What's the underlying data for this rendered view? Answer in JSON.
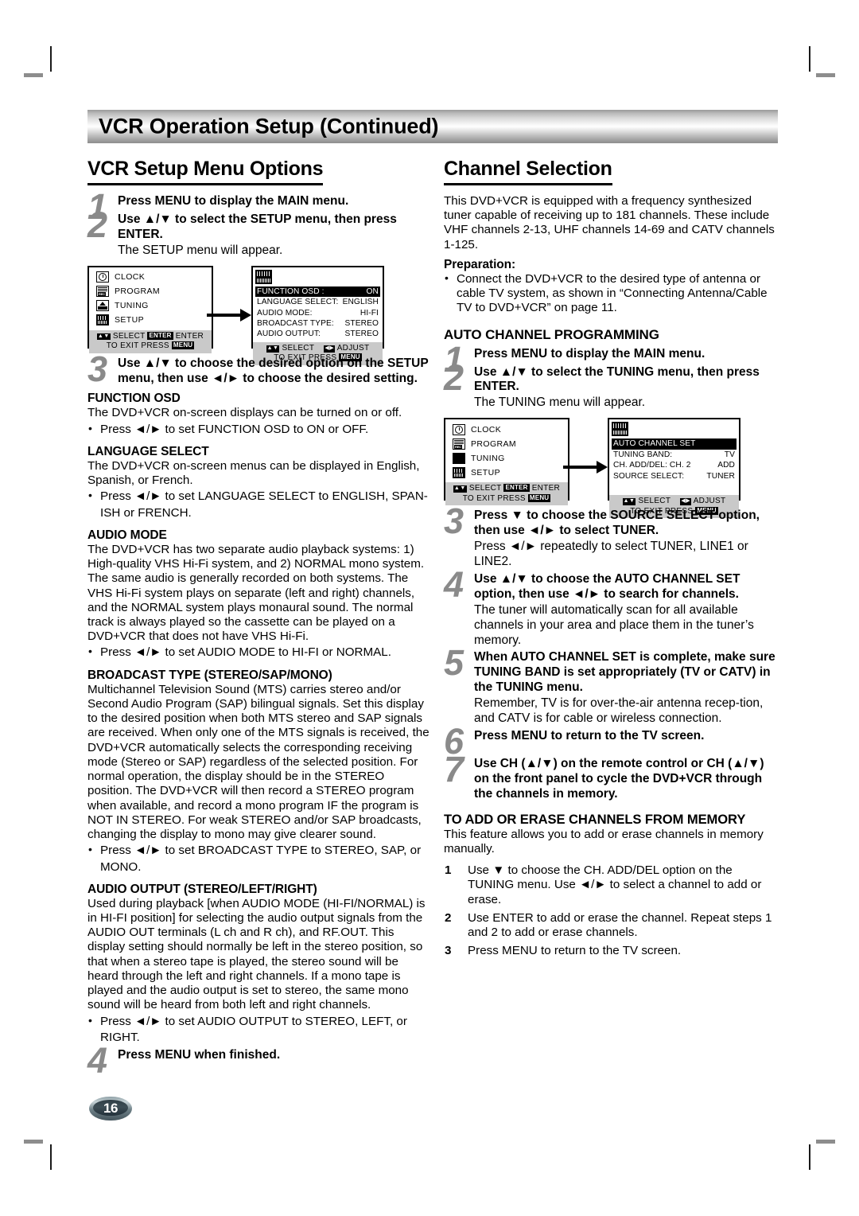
{
  "banner": {
    "title": "VCR Operation Setup (Continued)"
  },
  "page": {
    "number": "16"
  },
  "left": {
    "heading": "VCR Setup Menu Options",
    "steps": [
      {
        "num": "1",
        "bold": "Press MENU to display the MAIN menu.",
        "sub": ""
      },
      {
        "num": "2",
        "bold": "Use ▲/▼ to select the SETUP menu, then press ENTER.",
        "sub": "The SETUP menu will appear."
      },
      {
        "num": "3",
        "bold": "Use ▲/▼ to choose the desired option on the SETUP menu, then use ◄/► to choose the desired setting.",
        "sub": ""
      },
      {
        "num": "4",
        "bold": "Press MENU when finished.",
        "sub": ""
      }
    ],
    "osd": {
      "main_menu": {
        "items": [
          {
            "icon": "clock-icon",
            "label": "CLOCK",
            "selected": false
          },
          {
            "icon": "program-icon",
            "label": "PROGRAM",
            "selected": false
          },
          {
            "icon": "tuning-icon",
            "label": "TUNING",
            "selected": false
          },
          {
            "icon": "setup-icon",
            "label": "SETUP",
            "selected": true
          }
        ],
        "foot_line1_a": "SELECT",
        "foot_line1_key": "ENTER",
        "foot_line1_b": "ENTER",
        "foot_line2_a": "TO  EXIT PRESS",
        "foot_line2_key": "MENU"
      },
      "detail_menu": {
        "badge": "setup-icon",
        "rows": [
          {
            "label": "FUNCTION OSD :",
            "value": "ON",
            "highlight": true
          },
          {
            "label": "LANGUAGE SELECT:",
            "value": "ENGLISH",
            "highlight": false
          },
          {
            "label": "AUDIO MODE:",
            "value": "HI-FI",
            "highlight": false
          },
          {
            "label": "BROADCAST TYPE:",
            "value": "STEREO",
            "highlight": false
          },
          {
            "label": "AUDIO OUTPUT:",
            "value": "STEREO",
            "highlight": false
          }
        ],
        "foot_line1_a": "SELECT",
        "foot_line1_b": "ADJUST",
        "foot_line2_a": "TO  EXIT PRESS",
        "foot_line2_key": "MENU"
      }
    },
    "sections": [
      {
        "title": "FUNCTION OSD",
        "body": "The DVD+VCR on-screen displays can be turned on or off.",
        "bullet": "Press ◄/► to set FUNCTION OSD to ON or OFF.",
        "bullet_cont": ""
      },
      {
        "title": "LANGUAGE SELECT",
        "body": "The DVD+VCR on-screen menus can be displayed in English, Spanish, or French.",
        "bullet": "Press ◄/► to set LANGUAGE SELECT to ENGLISH, SPAN-",
        "bullet_cont": "ISH or FRENCH."
      },
      {
        "title": "AUDIO MODE",
        "body": "The DVD+VCR has two separate audio playback systems: 1) High-quality VHS Hi-Fi system, and 2) NORMAL mono system. The same audio is generally recorded on both systems. The VHS Hi-Fi system plays on separate (left and right) channels, and the NORMAL system plays monaural sound. The normal track is always played so the cassette can be played on a DVD+VCR that does not have VHS Hi-Fi.",
        "bullet": "Press ◄/► to set AUDIO MODE to HI-FI or NORMAL.",
        "bullet_cont": ""
      },
      {
        "title": "BROADCAST TYPE (STEREO/SAP/MONO)",
        "body": "Multichannel Television Sound (MTS) carries stereo and/or Second Audio Program (SAP) bilingual signals. Set this display to the desired position when both MTS stereo and SAP signals are received. When only one of the MTS signals is received, the DVD+VCR automatically selects the corresponding receiving mode (Stereo or SAP) regardless of the selected position. For normal operation, the display should be in the STEREO position. The DVD+VCR will then record a STEREO program when available, and record a mono program IF the program is NOT IN STEREO. For weak STEREO and/or SAP broadcasts, changing the display to mono may give clearer sound.",
        "bullet": "Press ◄/► to set BROADCAST TYPE to STEREO, SAP, or",
        "bullet_cont": "MONO."
      },
      {
        "title": "AUDIO OUTPUT (STEREO/LEFT/RIGHT)",
        "body": "Used during playback [when AUDIO MODE (HI-FI/NORMAL) is in HI-FI position] for selecting the audio output signals from the AUDIO OUT terminals (L ch and R ch), and RF.OUT. This display setting should normally be left in the stereo position, so that when a stereo tape is played, the stereo sound will be heard through the left and right channels. If a mono tape is played and the audio output is set to stereo, the same mono sound will be heard from both left and right channels.",
        "bullet": "Press ◄/► to set AUDIO OUTPUT to STEREO, LEFT, or",
        "bullet_cont": "RIGHT."
      }
    ]
  },
  "right": {
    "heading": "Channel Selection",
    "intro": "This DVD+VCR is equipped with a frequency synthesized tuner capable of receiving up to 181 channels. These include VHF channels 2-13, UHF channels 14-69 and CATV channels 1-125.",
    "preparation_title": "Preparation:",
    "preparation_bullet": "Connect the DVD+VCR to the desired type of antenna or cable TV system, as shown in “Connecting Antenna/Cable TV to DVD+VCR” on page 11.",
    "auto_title": "AUTO CHANNEL PROGRAMMING",
    "auto_steps": [
      {
        "num": "1",
        "bold": "Press MENU to display the MAIN menu.",
        "sub": ""
      },
      {
        "num": "2",
        "bold": "Use ▲/▼ to select the TUNING menu, then press ENTER.",
        "sub": "The TUNING menu will appear."
      },
      {
        "num": "3",
        "bold": "Press ▼ to choose the SOURCE SELECT option, then use ◄/► to select TUNER.",
        "sub": "Press ◄/► repeatedly to select TUNER, LINE1 or LINE2."
      },
      {
        "num": "4",
        "bold": "Use ▲/▼ to choose the AUTO CHANNEL SET option, then use ◄/► to search for channels.",
        "sub": "The tuner will automatically scan for all available channels in your area and place them in the tuner’s memory."
      },
      {
        "num": "5",
        "bold": "When AUTO CHANNEL SET is complete, make sure TUNING BAND is set appropriately (TV or CATV) in the TUNING menu.",
        "sub": "Remember, TV is for over-the-air antenna recep-tion, and CATV is for cable or wireless connection."
      },
      {
        "num": "6",
        "bold": "Press MENU to return to the TV screen.",
        "sub": ""
      },
      {
        "num": "7",
        "bold": "Use CH (▲/▼) on the remote control or CH (▲/▼) on the front panel to cycle the DVD+VCR through the channels in memory.",
        "sub": ""
      }
    ],
    "osd": {
      "main_menu": {
        "items": [
          {
            "icon": "clock-icon",
            "label": "CLOCK",
            "selected": false
          },
          {
            "icon": "program-icon",
            "label": "PROGRAM",
            "selected": false
          },
          {
            "icon": "tuning-icon",
            "label": "TUNING",
            "selected": true
          },
          {
            "icon": "setup-icon",
            "label": "SETUP",
            "selected": false
          }
        ],
        "foot_line1_a": "SELECT",
        "foot_line1_key": "ENTER",
        "foot_line1_b": "ENTER",
        "foot_line2_a": "TO  EXIT PRESS",
        "foot_line2_key": "MENU"
      },
      "detail_menu": {
        "badge": "tuning-icon",
        "rows": [
          {
            "label": "AUTO CHANNEL SET",
            "value": "",
            "highlight": true
          },
          {
            "label": "TUNING BAND:",
            "value": "TV",
            "highlight": false
          },
          {
            "label": "CH.  ADD/DEL: CH. 2",
            "value": "ADD",
            "highlight": false
          },
          {
            "label": "SOURCE SELECT:",
            "value": "TUNER",
            "highlight": false
          }
        ],
        "foot_line1_a": "SELECT",
        "foot_line1_b": "ADJUST",
        "foot_line2_a": "TO  EXIT PRESS",
        "foot_line2_key": "MENU"
      }
    },
    "addr_title": "TO ADD OR ERASE CHANNELS FROM MEMORY",
    "addr_body": "This feature allows you to add or erase channels in memory manually.",
    "addr_steps": [
      {
        "num": "1",
        "text": "Use ▼ to choose the CH. ADD/DEL option on the TUNING menu. Use ◄/► to select a channel to add or erase."
      },
      {
        "num": "2",
        "text": "Use ENTER to add or erase the channel. Repeat steps 1 and 2 to add or erase channels."
      },
      {
        "num": "3",
        "text": "Press MENU to return to the TV screen."
      }
    ]
  }
}
